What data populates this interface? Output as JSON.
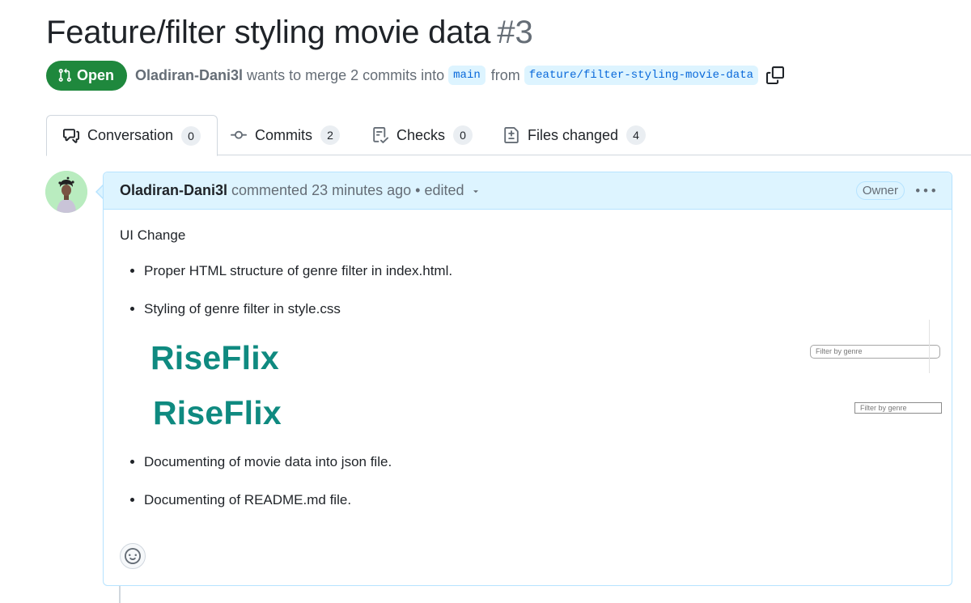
{
  "pull_request": {
    "title": "Feature/filter styling movie data",
    "number": "#3",
    "state": "Open",
    "author": "Oladiran-Dani3l",
    "merge_text": "wants to merge 2 commits into",
    "base_branch": "main",
    "from_text": "from",
    "head_branch": "feature/filter-styling-movie-data"
  },
  "tabs": [
    {
      "label": "Conversation",
      "count": "0",
      "icon": "comment-discussion-icon"
    },
    {
      "label": "Commits",
      "count": "2",
      "icon": "git-commit-icon"
    },
    {
      "label": "Checks",
      "count": "0",
      "icon": "checklist-icon"
    },
    {
      "label": "Files changed",
      "count": "4",
      "icon": "file-diff-icon"
    }
  ],
  "comment": {
    "author": "Oladiran-Dani3l",
    "action": "commented",
    "time": "23 minutes ago",
    "edited": "• edited",
    "role_badge": "Owner",
    "body": {
      "intro": "UI Change",
      "items": [
        "Proper HTML structure of genre filter in index.html.",
        "Styling of genre filter in style.css",
        "Documenting of movie data into json file.",
        "Documenting of README.md file."
      ],
      "screenshots": [
        {
          "logo": "RiseFlix",
          "filter_placeholder": "Filter by genre"
        },
        {
          "logo": "RiseFlix",
          "filter_placeholder": "Filter by genre"
        }
      ]
    }
  },
  "colors": {
    "open_badge": "#1f883d",
    "branch_bg": "#ddf4ff",
    "branch_text": "#0969da",
    "comment_header_bg": "#ddf4ff",
    "logo_teal": "#0f8a80"
  }
}
